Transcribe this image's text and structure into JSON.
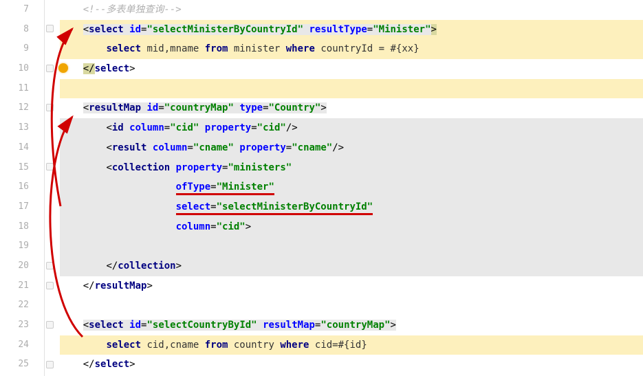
{
  "gutter": {
    "start": 7,
    "end": 25
  },
  "lines": {
    "l7": {
      "comment": "<!--多表单独查询-->"
    },
    "l8": {
      "tag_open": "<",
      "tag": "select",
      "attr1": "id",
      "val1": "\"selectMinisterByCountryId\"",
      "attr2": "resultType",
      "val2": "\"Minister\"",
      "tag_close": ">"
    },
    "l9": {
      "kw1": "select",
      "txt1": " mid,mname ",
      "kw2": "from",
      "txt2": " minister ",
      "kw3": "where",
      "txt3": " countryId = #{xx}"
    },
    "l10": {
      "close_open": "</",
      "tag": "select",
      "close_end": ">"
    },
    "l12": {
      "tag_open": "<",
      "tag": "resultMap",
      "attr1": "id",
      "val1": "\"countryMap\"",
      "attr2": "type",
      "val2": "\"Country\"",
      "tag_close": ">"
    },
    "l13": {
      "tag_open": "<",
      "tag": "id",
      "attr1": "column",
      "val1": "\"cid\"",
      "attr2": "property",
      "val2": "\"cid\"",
      "tag_close": "/>"
    },
    "l14": {
      "tag_open": "<",
      "tag": "result",
      "attr1": "column",
      "val1": "\"cname\"",
      "attr2": "property",
      "val2": "\"cname\"",
      "tag_close": "/>"
    },
    "l15": {
      "tag_open": "<",
      "tag": "collection",
      "attr1": "property",
      "val1": "\"ministers\""
    },
    "l16": {
      "attr": "ofType",
      "val": "\"Minister\""
    },
    "l17": {
      "attr": "select",
      "val": "\"selectMinisterByCountryId\""
    },
    "l18": {
      "attr": "column",
      "val": "\"cid\"",
      "close": ">"
    },
    "l20": {
      "close_open": "</",
      "tag": "collection",
      "close_end": ">"
    },
    "l21": {
      "close_open": "</",
      "tag": "resultMap",
      "close_end": ">"
    },
    "l23": {
      "tag_open": "<",
      "tag": "select",
      "attr1": "id",
      "val1": "\"selectCountryById\"",
      "attr2": "resultMap",
      "val2": "\"countryMap\"",
      "tag_close": ">"
    },
    "l24": {
      "kw1": "select",
      "txt1": " cid,cname ",
      "kw2": "from",
      "txt2": " country ",
      "kw3": "where",
      "txt3": " cid=#{id}"
    },
    "l25": {
      "close_open": "</",
      "tag": "select",
      "close_end": ">"
    }
  },
  "indent": {
    "i1": "    ",
    "i2": "        ",
    "i3": "                    "
  },
  "eq": "="
}
